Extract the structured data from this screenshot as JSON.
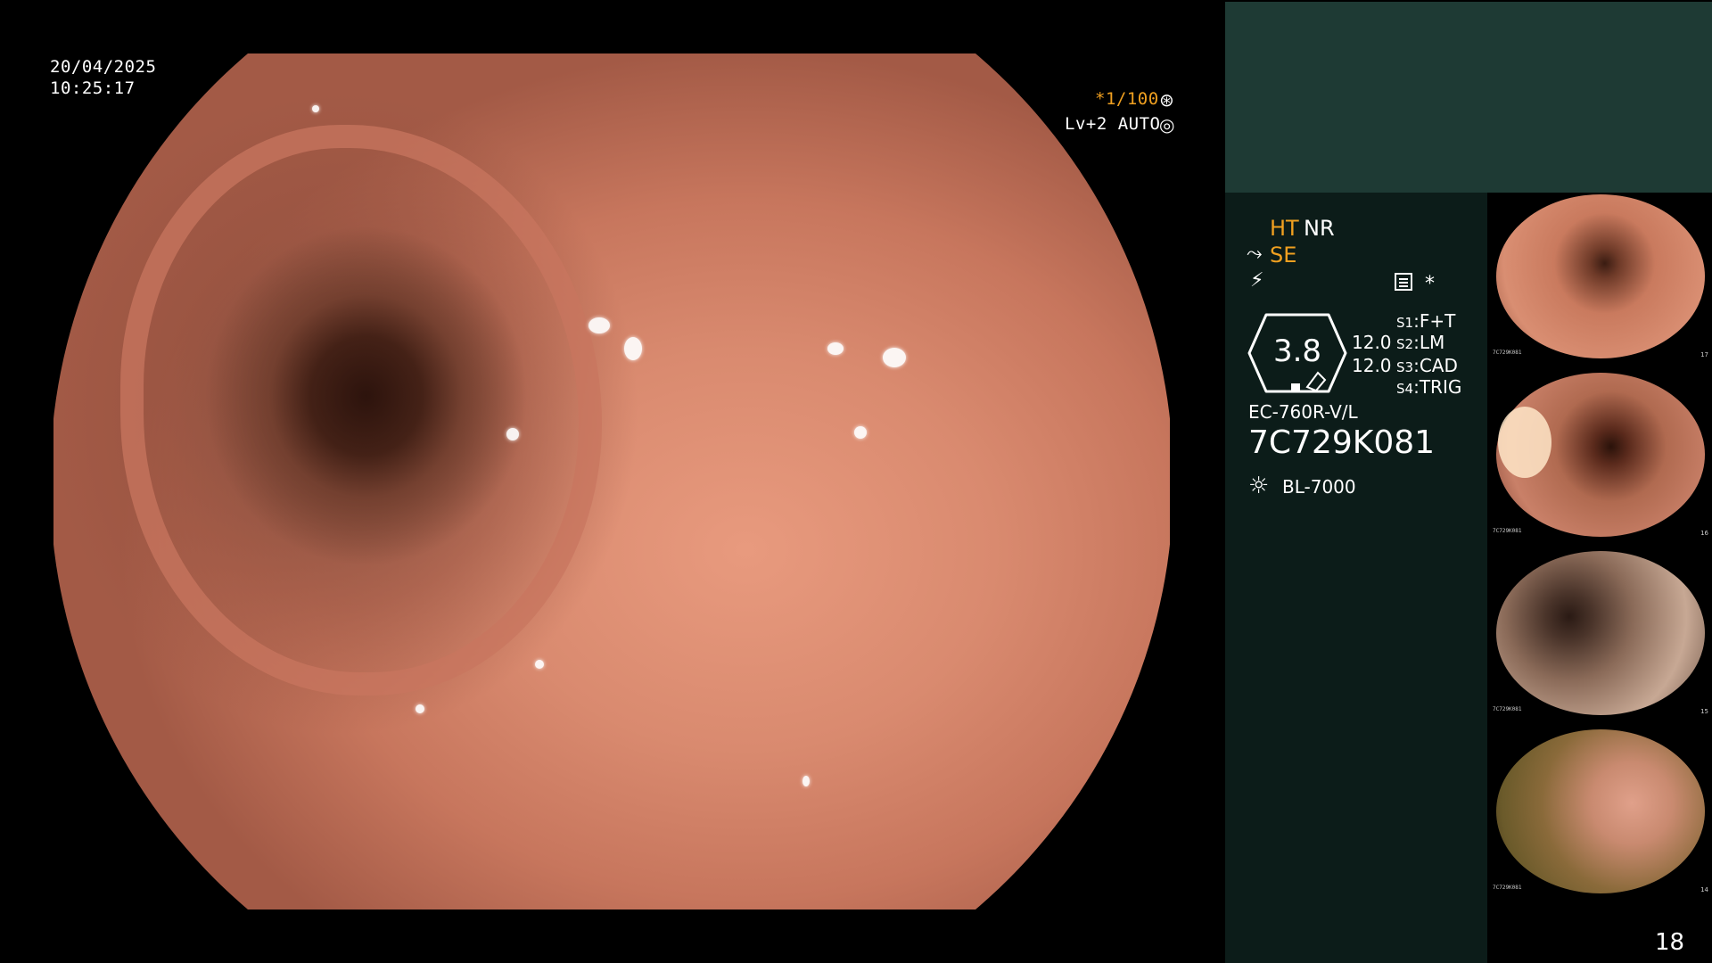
{
  "osd": {
    "date": "20/04/2025",
    "time": "10:25:17",
    "shutter": "*1/100",
    "shutter_icon": "aperture-icon",
    "level": "Lv+2 AUTO",
    "auto_icon": "iris-icon"
  },
  "panel": {
    "ht": "HT",
    "nr": "NR",
    "se": "SE",
    "se_icon": "curve-icon",
    "flash_icon": "flash-icon",
    "menu_icon": "menu-icon",
    "star": "*",
    "enhance_value": "3.8",
    "ratio1": "12.0",
    "ratio2": "12.0",
    "switches": [
      {
        "key": "S1",
        "value": "F+T"
      },
      {
        "key": "S2",
        "value": "LM"
      },
      {
        "key": "S3",
        "value": "CAD"
      },
      {
        "key": "S4",
        "value": "TRIG"
      }
    ],
    "scope_model": "EC-760R-V/L",
    "serial": "7C729K081",
    "light_icon": "light-source-icon",
    "light_source": "BL-7000"
  },
  "thumbnails": [
    {
      "label": "7C729K081",
      "number": "17"
    },
    {
      "label": "7C729K081",
      "number": "16"
    },
    {
      "label": "7C729K081",
      "number": "15"
    },
    {
      "label": "7C729K081",
      "number": "14"
    }
  ],
  "page_number": "18",
  "colors": {
    "accent": "#f0a020",
    "panel_top": "#1e3a34",
    "panel": "#0c1c19",
    "mucosa": "#d98a6f"
  }
}
